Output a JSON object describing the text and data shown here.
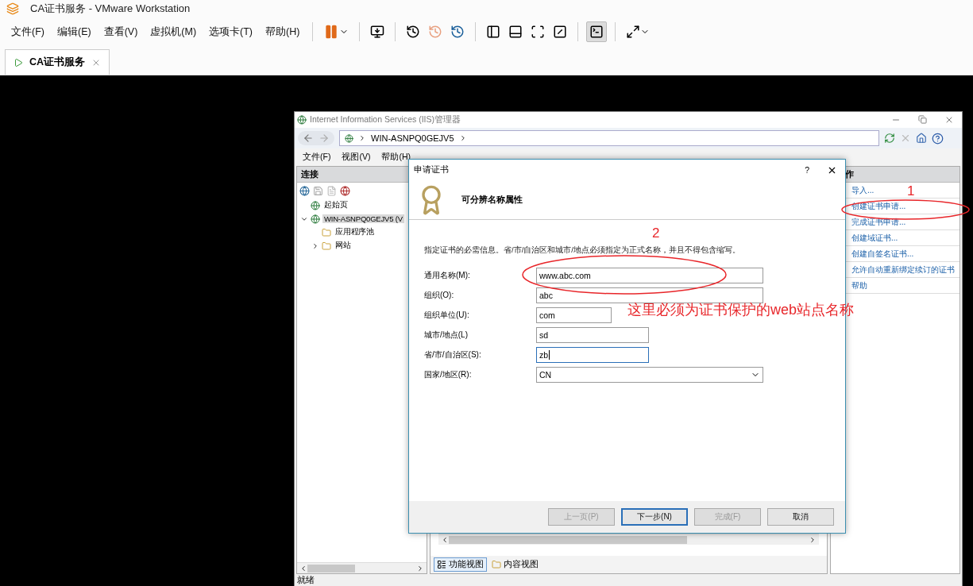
{
  "vmware": {
    "title": "CA证书服务 - VMware Workstation",
    "menu": [
      "文件(F)",
      "编辑(E)",
      "查看(V)",
      "虚拟机(M)",
      "选项卡(T)",
      "帮助(H)"
    ],
    "console_active": true,
    "tab": {
      "label": "CA证书服务",
      "selected": true
    }
  },
  "iis": {
    "title": "Internet Information Services (IIS)管理器",
    "address": "WIN-ASNPQ0GEJV5",
    "menu": [
      "文件(F)",
      "视图(V)",
      "帮助(H)"
    ],
    "connections": {
      "header": "连接",
      "tree": [
        {
          "label": "起始页",
          "selected": false
        },
        {
          "label": "WIN-ASNPQ0GEJV5 (V",
          "selected": true,
          "expanded": true,
          "children": [
            {
              "label": "应用程序池",
              "selected": false
            },
            {
              "label": "网站",
              "selected": false,
              "expanded": false
            }
          ]
        }
      ]
    },
    "view_tabs": [
      {
        "label": "功能视图",
        "selected": true
      },
      {
        "label": "内容视图",
        "selected": false
      }
    ],
    "actions": {
      "header": "作",
      "items": [
        "导入...",
        "创建证书申请...",
        "完成证书申请...",
        "创建域证书...",
        "创建自签名证书...",
        "允许自动重新绑定续订的证书",
        "帮助"
      ]
    },
    "status": "就绪"
  },
  "dialog": {
    "title": "申请证书",
    "help": "?",
    "heading": "可分辨名称属性",
    "instruction": "指定证书的必需信息。省/市/自治区和城市/地点必须指定为正式名称，并且不得包含缩写。",
    "fields": [
      {
        "kind": "text",
        "label": "通用名称(M):",
        "value": "www.abc.com",
        "focused": false
      },
      {
        "kind": "text",
        "label": "组织(O):",
        "value": "abc",
        "focused": false
      },
      {
        "kind": "text",
        "label": "组织单位(U):",
        "value": "com",
        "focused": false
      },
      {
        "kind": "text",
        "label": "城市/地点(L)",
        "value": "sd",
        "focused": false
      },
      {
        "kind": "text",
        "label": "省/市/自治区(S):",
        "value": "zb",
        "focused": true
      },
      {
        "kind": "select",
        "label": "国家/地区(R):",
        "value": "CN",
        "focused": false
      }
    ],
    "buttons": [
      {
        "label": "上一页(P)",
        "disabled": true,
        "default": false
      },
      {
        "label": "下一步(N)",
        "disabled": false,
        "default": true
      },
      {
        "label": "完成(F)",
        "disabled": true,
        "default": false
      },
      {
        "label": "取消",
        "disabled": false,
        "default": false
      }
    ]
  },
  "annotations": {
    "mark_1": "1",
    "mark_2": "2",
    "note": "这里必须为证书保护的web站点名称"
  }
}
